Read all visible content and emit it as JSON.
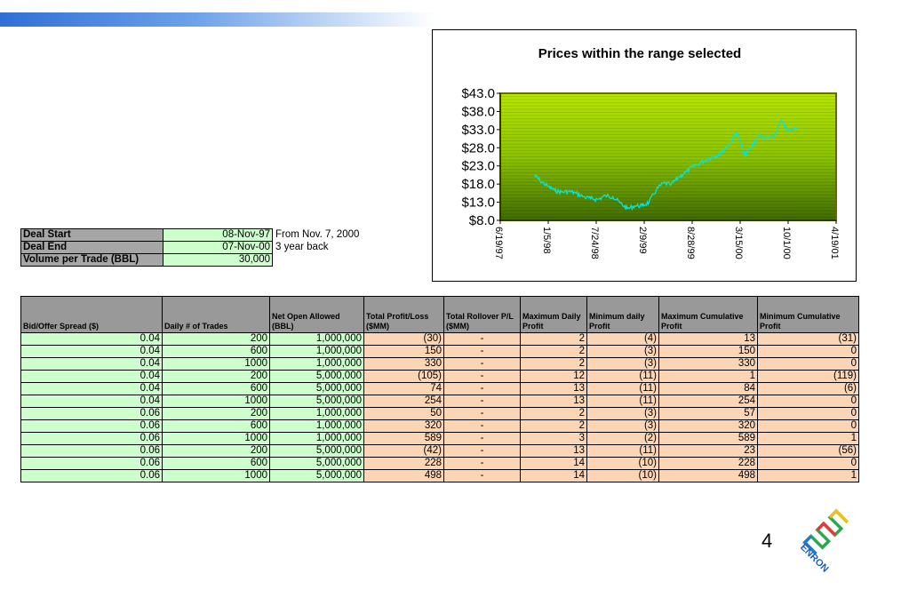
{
  "slide": {
    "page_number": "4",
    "logo_text": "ENRON"
  },
  "colors": {
    "header_gray": "#999999",
    "input_green": "#ccffcc",
    "output_orange": "#fcd5b4",
    "chart_line": "#00e5e5",
    "plot_bg": "#8fd000"
  },
  "deal": {
    "rows": [
      {
        "label": "Deal Start",
        "value": "08-Nov-97",
        "note": "From Nov. 7, 2000"
      },
      {
        "label": "Deal End",
        "value": "07-Nov-00",
        "note": "3 year back"
      },
      {
        "label": "Volume per Trade (BBL)",
        "value": "30,000",
        "note": ""
      }
    ]
  },
  "table": {
    "headers": [
      "Bid/Offer Spread ($)",
      "Daily # of Trades",
      "Net Open Allowed (BBL)",
      "Total Profit/Loss ($MM)",
      "Total Rollover P/L ($MM)",
      "Maximum Daily Profit",
      "Minimum daily Profit",
      "Maximum Cumulative Profit",
      "Minimum Cumulative Profit"
    ],
    "rows": [
      [
        "0.04",
        "200",
        "1,000,000",
        "(30)",
        "-",
        "2",
        "(4)",
        "13",
        "(31)"
      ],
      [
        "0.04",
        "600",
        "1,000,000",
        "150",
        "-",
        "2",
        "(3)",
        "150",
        "0"
      ],
      [
        "0.04",
        "1000",
        "1,000,000",
        "330",
        "-",
        "2",
        "(3)",
        "330",
        "0"
      ],
      [
        "0.04",
        "200",
        "5,000,000",
        "(105)",
        "-",
        "12",
        "(11)",
        "1",
        "(119)"
      ],
      [
        "0.04",
        "600",
        "5,000,000",
        "74",
        "-",
        "13",
        "(11)",
        "84",
        "(6)"
      ],
      [
        "0.04",
        "1000",
        "5,000,000",
        "254",
        "-",
        "13",
        "(11)",
        "254",
        "0"
      ],
      [
        "0.06",
        "200",
        "1,000,000",
        "50",
        "-",
        "2",
        "(3)",
        "57",
        "0"
      ],
      [
        "0.06",
        "600",
        "1,000,000",
        "320",
        "-",
        "2",
        "(3)",
        "320",
        "0"
      ],
      [
        "0.06",
        "1000",
        "1,000,000",
        "589",
        "-",
        "3",
        "(2)",
        "589",
        "1"
      ],
      [
        "0.06",
        "200",
        "5,000,000",
        "(42)",
        "-",
        "13",
        "(11)",
        "23",
        "(56)"
      ],
      [
        "0.06",
        "600",
        "5,000,000",
        "228",
        "-",
        "14",
        "(10)",
        "228",
        "0"
      ],
      [
        "0.06",
        "1000",
        "5,000,000",
        "498",
        "-",
        "14",
        "(10)",
        "498",
        "1"
      ]
    ]
  },
  "chart_data": {
    "type": "line",
    "title": "Prices within the range selected",
    "xlabel": "",
    "ylabel": "",
    "ylim": [
      8.0,
      43.0
    ],
    "y_ticks": [
      "$8.0",
      "$13.0",
      "$18.0",
      "$23.0",
      "$28.0",
      "$33.0",
      "$38.0",
      "$43.0"
    ],
    "x_ticks": [
      "6/19/97",
      "1/5/98",
      "7/24/98",
      "2/9/99",
      "8/28/99",
      "3/15/00",
      "10/1/00",
      "4/19/01"
    ],
    "x": [
      "1997-11-08",
      "1997-12-01",
      "1998-01-01",
      "1998-02-01",
      "1998-03-01",
      "1998-04-01",
      "1998-05-01",
      "1998-06-01",
      "1998-07-01",
      "1998-08-01",
      "1998-09-01",
      "1998-10-01",
      "1998-11-01",
      "1998-12-01",
      "1999-01-01",
      "1999-02-01",
      "1999-03-01",
      "1999-04-01",
      "1999-05-01",
      "1999-06-01",
      "1999-07-01",
      "1999-08-01",
      "1999-09-01",
      "1999-10-01",
      "1999-11-01",
      "1999-12-01",
      "2000-01-01",
      "2000-02-01",
      "2000-03-01",
      "2000-04-01",
      "2000-05-01",
      "2000-06-01",
      "2000-07-01",
      "2000-08-01",
      "2000-09-01",
      "2000-10-01",
      "2000-11-07"
    ],
    "series": [
      {
        "values": [
          20.5,
          19.0,
          17.5,
          16.2,
          15.8,
          16.0,
          15.5,
          14.5,
          14.0,
          13.8,
          14.8,
          14.5,
          12.8,
          11.2,
          12.0,
          12.0,
          13.0,
          16.5,
          18.3,
          17.8,
          19.8,
          21.3,
          22.8,
          23.8,
          25.0,
          25.6,
          27.0,
          29.3,
          32.5,
          25.8,
          28.2,
          31.5,
          30.5,
          30.8,
          35.5,
          32.5,
          33.5
        ]
      }
    ],
    "legend": "none",
    "grid": true
  }
}
